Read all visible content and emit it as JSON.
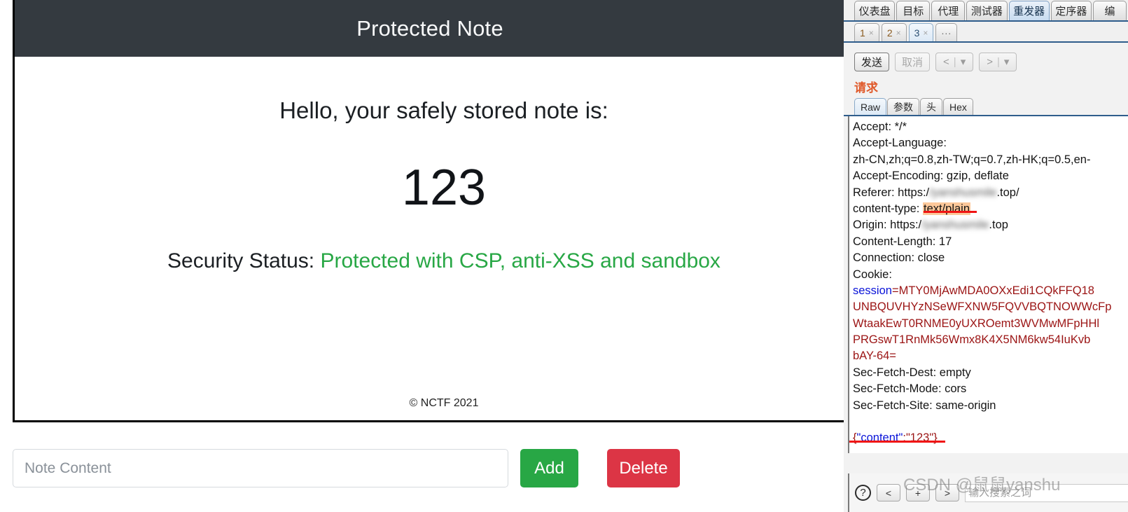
{
  "browser_page": {
    "header_title": "Protected Note",
    "greeting": "Hello, your safely stored note is:",
    "note_value": "123",
    "status_label": "Security Status:",
    "status_value": "Protected with CSP, anti-XSS and sandbox",
    "footer": "© NCTF 2021",
    "colors": {
      "header_bg": "#343a40",
      "status_green": "#28a745",
      "add_green": "#28a745",
      "delete_red": "#dc3545"
    },
    "form": {
      "input_placeholder": "Note Content",
      "input_value": "",
      "add_label": "Add",
      "delete_label": "Delete"
    }
  },
  "burp": {
    "main_tabs": [
      {
        "label": "仪表盘",
        "active": false
      },
      {
        "label": "目标",
        "active": false
      },
      {
        "label": "代理",
        "active": false
      },
      {
        "label": "测试器",
        "active": false
      },
      {
        "label": "重发器",
        "active": true
      },
      {
        "label": "定序器",
        "active": false
      },
      {
        "label": "编",
        "active": false
      }
    ],
    "sub_tabs": [
      {
        "label": "1",
        "close": "×",
        "active": false
      },
      {
        "label": "2",
        "close": "×",
        "active": false
      },
      {
        "label": "3",
        "close": "×",
        "active": true
      },
      {
        "label": "...",
        "close": "",
        "active": false
      }
    ],
    "actions": {
      "send": "发送",
      "cancel": "取消",
      "prev": "<",
      "next": ">",
      "caret": "▾",
      "divider": "|"
    },
    "request_label": "请求",
    "view_tabs": [
      {
        "label": "Raw",
        "active": true
      },
      {
        "label": "参数",
        "active": false
      },
      {
        "label": "头",
        "active": false
      },
      {
        "label": "Hex",
        "active": false
      }
    ],
    "raw_lines": [
      {
        "text": "Accept: */*"
      },
      {
        "text": "Accept-Language:"
      },
      {
        "text": "zh-CN,zh;q=0.8,zh-TW;q=0.7,zh-HK;q=0.5,en-"
      },
      {
        "text": "Accept-Encoding: gzip, deflate"
      }
    ],
    "referer_prefix": "Referer: https:/",
    "referer_blurred": "/yanshusmile",
    "referer_suffix": ".top/",
    "content_type_label": "content-type: ",
    "content_type_value": "text/plain",
    "origin_prefix": "Origin: https:/",
    "origin_blurred": "/yanshusmile",
    "origin_suffix": ".top",
    "content_length": "Content-Length: 17",
    "connection": "Connection: close",
    "cookie_label": "Cookie:",
    "cookie_name": "session",
    "cookie_eq": "=",
    "cookie_value_lines": [
      "MTY0MjAwMDA0OXxEdi1CQkFFQ18",
      "UNBQUVHYzNSeWFXNW5FQVVBQTNOWWcFp",
      "WtaakEwT0RNME0yUXROemt3WVMwMFpHHl",
      "PRGswT1RnMk56Wmx8K4X5NM6kw54IuKvb",
      "bAY-64="
    ],
    "trailer_lines": [
      "Sec-Fetch-Dest: empty",
      "Sec-Fetch-Mode: cors",
      "Sec-Fetch-Site: same-origin"
    ],
    "body": {
      "open_brace": "{",
      "key": "\"content\"",
      "colon": ":",
      "value": "\"123\"",
      "close_brace": "}"
    },
    "bottom_toolbar": {
      "help": "?",
      "prev": "<",
      "plus": "+",
      "next": ">",
      "search_placeholder": "输入搜索之词",
      "search_value": ""
    }
  },
  "watermark": "CSDN @鼠鼠yanshu"
}
